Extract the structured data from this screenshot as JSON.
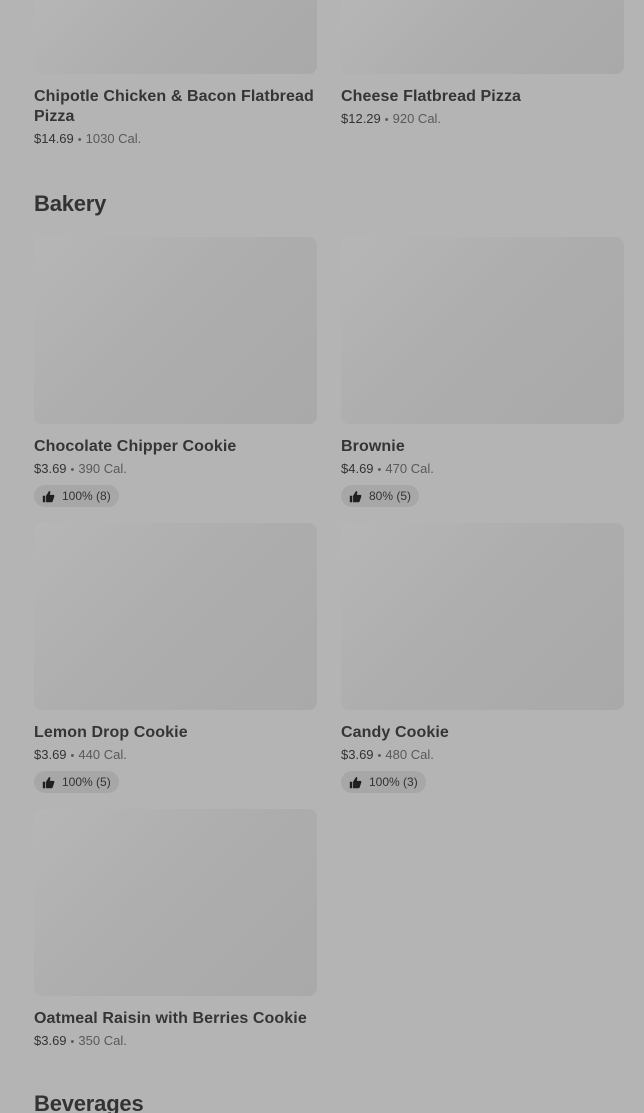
{
  "top_items": [
    {
      "name": "Chipotle Chicken & Bacon Flatbread Pizza",
      "price": "$14.69",
      "separator": "•",
      "calories": "1030 Cal."
    },
    {
      "name": "Cheese Flatbread Pizza",
      "price": "$12.29",
      "separator": "•",
      "calories": "920 Cal."
    }
  ],
  "bakery": {
    "title": "Bakery",
    "items": [
      {
        "name": "Chocolate Chipper Cookie",
        "price": "$3.69",
        "separator": "•",
        "calories": "390 Cal.",
        "rating": "100% (8)"
      },
      {
        "name": "Brownie",
        "price": "$4.69",
        "separator": "•",
        "calories": "470 Cal.",
        "rating": "80% (5)"
      },
      {
        "name": "Lemon Drop Cookie",
        "price": "$3.69",
        "separator": "•",
        "calories": "440 Cal.",
        "rating": "100% (5)"
      },
      {
        "name": "Candy Cookie",
        "price": "$3.69",
        "separator": "•",
        "calories": "480 Cal.",
        "rating": "100% (3)"
      },
      {
        "name": "Oatmeal Raisin with Berries Cookie",
        "price": "$3.69",
        "separator": "•",
        "calories": "350 Cal."
      }
    ]
  },
  "beverages": {
    "title": "Beverages"
  },
  "icons": {
    "rating": "thumbs-up-icon"
  },
  "colors": {
    "background": "#b4b4b4",
    "badge": "#a7a7a7",
    "text": "#333333"
  }
}
